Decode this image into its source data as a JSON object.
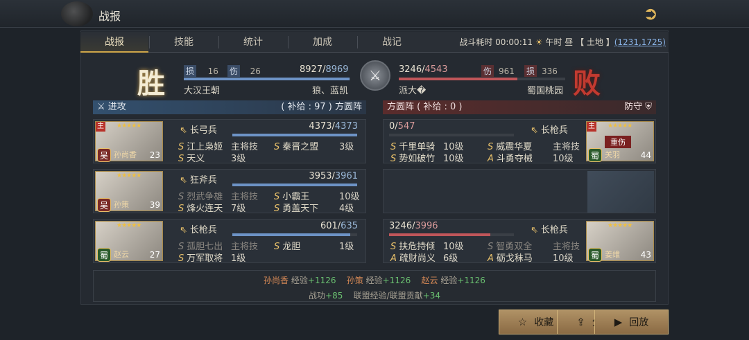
{
  "header": {
    "title": "战报"
  },
  "tabs": [
    "战报",
    "技能",
    "统计",
    "加成",
    "战记"
  ],
  "battle_info": {
    "duration_label": "战斗耗时",
    "duration": "00:00:11",
    "time_label": "午时 昼",
    "terrain": "【 土地 】",
    "coords": "(1231,1725)"
  },
  "result": {
    "win": "胜",
    "lose": "败"
  },
  "left": {
    "loss_label": "损",
    "loss": "16",
    "hurt_label": "伤",
    "hurt": "26",
    "troops": "8927",
    "troops_max": "8969",
    "troops_ratio": 0.995,
    "alliance": "大汉王朝",
    "player": "狼、蓝凯"
  },
  "right": {
    "loss_label": "损",
    "loss": "336",
    "hurt_label": "伤",
    "hurt": "961",
    "troops": "3246",
    "troops_max": "4543",
    "troops_ratio": 0.714,
    "player": "派大�",
    "alliance": "蜀国桃园"
  },
  "attack_header": {
    "label": "进攻",
    "formation": "( 补给 : 97 ) 方圆阵"
  },
  "defend_header": {
    "formation": "方圆阵 ( 补给 : 0 )",
    "label": "防守"
  },
  "attackers": [
    {
      "name": "孙尚香",
      "level": "23",
      "faction": "吴",
      "main": "主",
      "unit": "长弓兵",
      "hp": "4373",
      "hp_max": "4373",
      "hp_ratio": 1.0,
      "skills": [
        {
          "g": "S",
          "name": "江上枭姬",
          "lvl": "主将技",
          "dim": false
        },
        {
          "g": "S",
          "name": "秦晋之盟",
          "lvl": "3级",
          "dim": false
        },
        {
          "g": "S",
          "name": "天义",
          "lvl": "3级",
          "dim": false
        }
      ]
    },
    {
      "name": "孙策",
      "level": "39",
      "faction": "吴",
      "main": "",
      "unit": "狂斧兵",
      "hp": "3953",
      "hp_max": "3961",
      "hp_ratio": 0.998,
      "skills": [
        {
          "g": "S",
          "name": "烈武争雄",
          "lvl": "主将技",
          "dim": true
        },
        {
          "g": "S",
          "name": "小霸王",
          "lvl": "10级",
          "dim": false
        },
        {
          "g": "S",
          "name": "烽火连天",
          "lvl": "7级",
          "dim": false
        },
        {
          "g": "S",
          "name": "勇盖天下",
          "lvl": "4级",
          "dim": false
        }
      ]
    },
    {
      "name": "赵云",
      "level": "27",
      "faction": "蜀",
      "main": "",
      "unit": "长枪兵",
      "hp": "601",
      "hp_max": "635",
      "hp_ratio": 0.946,
      "skills": [
        {
          "g": "S",
          "name": "孤胆七出",
          "lvl": "主将技",
          "dim": true
        },
        {
          "g": "S",
          "name": "龙胆",
          "lvl": "1级",
          "dim": false
        },
        {
          "g": "S",
          "name": "万军取将",
          "lvl": "1级",
          "dim": false
        }
      ]
    }
  ],
  "defenders": [
    {
      "name": "关羽",
      "level": "44",
      "faction": "蜀",
      "main": "主",
      "status": "重伤",
      "unit": "长枪兵",
      "hp": "0",
      "hp_max": "547",
      "hp_ratio": 0.0,
      "skills": [
        {
          "g": "S",
          "name": "千里单骑",
          "lvl": "10级",
          "dim": false
        },
        {
          "g": "S",
          "name": "威震华夏",
          "lvl": "主将技",
          "dim": false
        },
        {
          "g": "S",
          "name": "势如破竹",
          "lvl": "10级",
          "dim": false
        },
        {
          "g": "A",
          "name": "斗勇夺械",
          "lvl": "10级",
          "dim": false
        }
      ]
    },
    {
      "name": "姜维",
      "level": "43",
      "faction": "蜀",
      "main": "",
      "unit": "长枪兵",
      "hp": "3246",
      "hp_max": "3996",
      "hp_ratio": 0.812,
      "skills": [
        {
          "g": "S",
          "name": "扶危持倾",
          "lvl": "10级",
          "dim": false
        },
        {
          "g": "S",
          "name": "智勇双全",
          "lvl": "主将技",
          "dim": true
        },
        {
          "g": "A",
          "name": "疏财尚义",
          "lvl": "6级",
          "dim": false
        },
        {
          "g": "A",
          "name": "砺戈秣马",
          "lvl": "10级",
          "dim": false
        }
      ]
    }
  ],
  "footer": {
    "exp": [
      {
        "name": "孙尚香",
        "label": "经验",
        "val": "+1126"
      },
      {
        "name": "孙策",
        "label": "经验",
        "val": "+1126"
      },
      {
        "name": "赵云",
        "label": "经验",
        "val": "+1126"
      }
    ],
    "merit_label": "战功",
    "merit": "+85",
    "alliance_label": "联盟经验/联盟贡献",
    "alliance_val": "+34"
  },
  "buttons": {
    "collect": "收藏",
    "share": "分享",
    "replay": "回放"
  }
}
